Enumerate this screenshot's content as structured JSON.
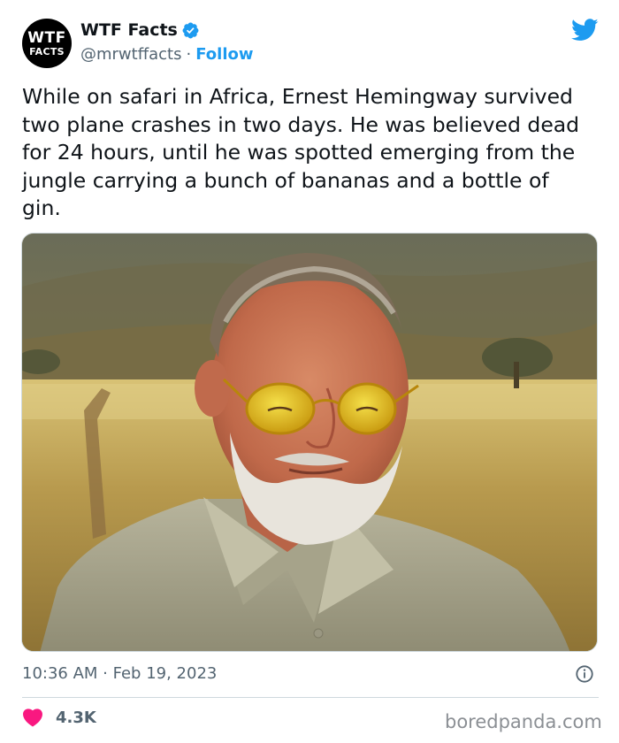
{
  "author": {
    "avatar_line1": "WTF",
    "avatar_line2": "FACTS",
    "display_name": "WTF Facts",
    "handle": "@mrwtffacts",
    "separator": "·",
    "follow_label": "Follow"
  },
  "tweet": {
    "text": "While on safari in Africa, Ernest Hemingway survived two plane crashes in two days. He was believed dead for 24 hours, until he was spotted emerging from the jungle carrying a bunch of bananas and a bottle of gin.",
    "timestamp": "10:36 AM · Feb 19, 2023",
    "like_count": "4.3K"
  },
  "icons": {
    "verified": "verified-badge-icon",
    "brand": "twitter-bird-icon",
    "info": "info-icon",
    "like": "heart-icon"
  },
  "colors": {
    "accent": "#1d9bf0",
    "like": "#f91880",
    "secondary_text": "#536471"
  },
  "watermark": "boredpanda.com"
}
